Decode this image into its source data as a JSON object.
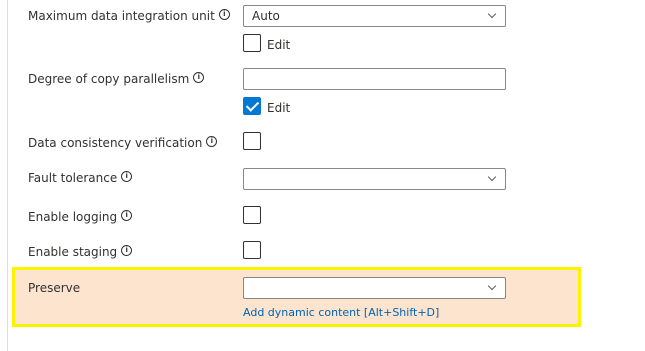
{
  "settings": {
    "max_diu": {
      "label": "Maximum data integration unit",
      "value": "Auto",
      "edit_label": "Edit",
      "edit_checked": false
    },
    "parallelism": {
      "label": "Degree of copy parallelism",
      "value": "",
      "edit_label": "Edit",
      "edit_checked": true
    },
    "consistency": {
      "label": "Data consistency verification",
      "checked": false
    },
    "fault_tolerance": {
      "label": "Fault tolerance",
      "value": ""
    },
    "logging": {
      "label": "Enable logging",
      "checked": false
    },
    "staging": {
      "label": "Enable staging",
      "checked": false
    },
    "preserve": {
      "label": "Preserve",
      "value": "",
      "dynamic_link": "Add dynamic content [Alt+Shift+D]"
    }
  },
  "info_glyph": "i",
  "colors": {
    "highlight_border": "#fff200",
    "highlight_background": "#fde4cf",
    "checkbox_checked": "#0078d4",
    "link": "#0063b1"
  }
}
